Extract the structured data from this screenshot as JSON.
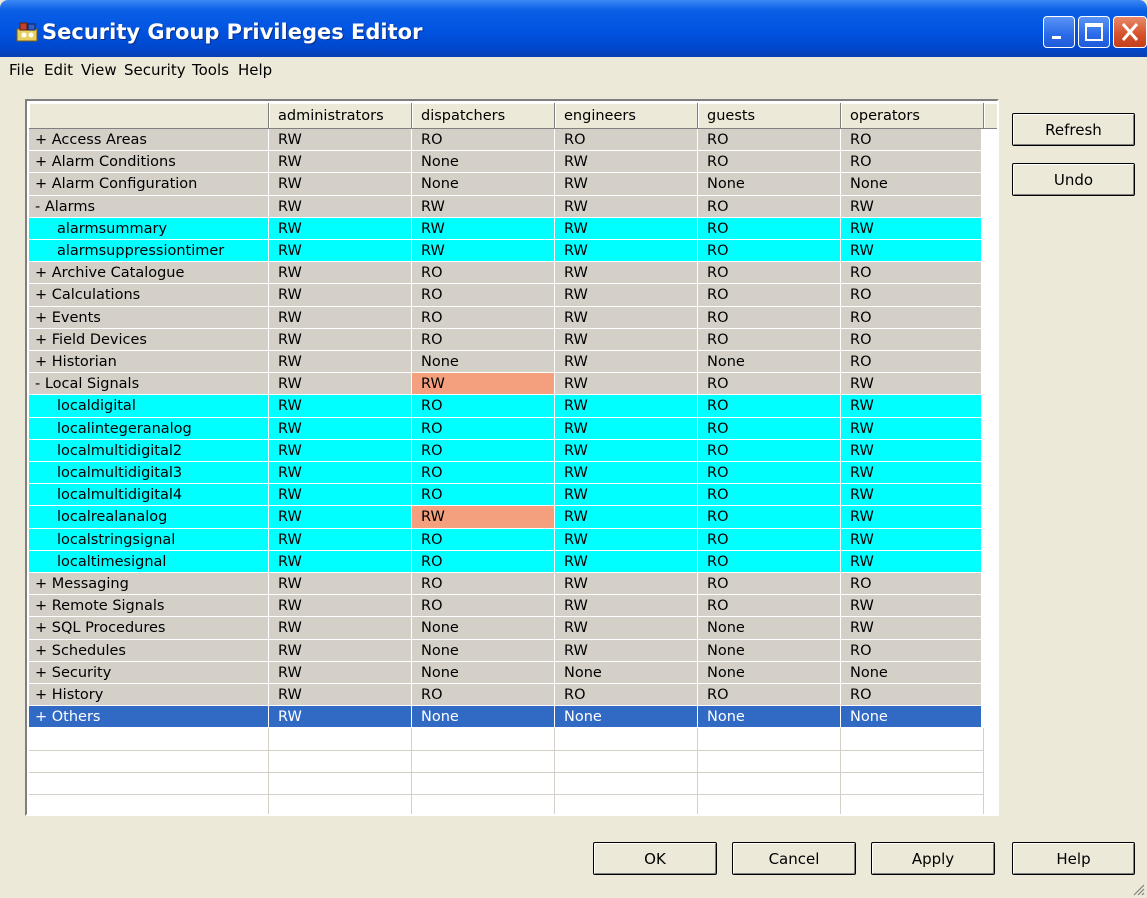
{
  "window": {
    "title": "Security Group Privileges Editor"
  },
  "menu": [
    "File",
    "Edit",
    "View",
    "Security",
    "Tools",
    "Help"
  ],
  "columns": [
    "administrators",
    "dispatchers",
    "engineers",
    "guests",
    "operators"
  ],
  "rows": [
    {
      "label": "+ Access Areas",
      "type": "group",
      "values": [
        "RW",
        "RO",
        "RO",
        "RO",
        "RO"
      ]
    },
    {
      "label": "+ Alarm Conditions",
      "type": "group",
      "values": [
        "RW",
        "None",
        "RW",
        "RO",
        "RO"
      ]
    },
    {
      "label": "+ Alarm Configuration",
      "type": "group",
      "values": [
        "RW",
        "None",
        "RW",
        "None",
        "None"
      ]
    },
    {
      "label": "- Alarms",
      "type": "group",
      "values": [
        "RW",
        "RW",
        "RW",
        "RO",
        "RW"
      ]
    },
    {
      "label": "alarmsummary",
      "type": "child",
      "values": [
        "RW",
        "RW",
        "RW",
        "RO",
        "RW"
      ]
    },
    {
      "label": "alarmsuppressiontimer",
      "type": "child",
      "values": [
        "RW",
        "RW",
        "RW",
        "RO",
        "RW"
      ]
    },
    {
      "label": "+ Archive Catalogue",
      "type": "group",
      "values": [
        "RW",
        "RO",
        "RW",
        "RO",
        "RO"
      ]
    },
    {
      "label": "+ Calculations",
      "type": "group",
      "values": [
        "RW",
        "RO",
        "RW",
        "RO",
        "RO"
      ]
    },
    {
      "label": "+ Events",
      "type": "group",
      "values": [
        "RW",
        "RO",
        "RW",
        "RO",
        "RO"
      ]
    },
    {
      "label": "+ Field Devices",
      "type": "group",
      "values": [
        "RW",
        "RO",
        "RW",
        "RO",
        "RO"
      ]
    },
    {
      "label": "+ Historian",
      "type": "group",
      "values": [
        "RW",
        "None",
        "RW",
        "None",
        "RO"
      ]
    },
    {
      "label": "- Local Signals",
      "type": "group",
      "values": [
        "RW",
        "RW",
        "RW",
        "RO",
        "RW"
      ],
      "highlight": [
        1
      ]
    },
    {
      "label": "localdigital",
      "type": "child",
      "values": [
        "RW",
        "RO",
        "RW",
        "RO",
        "RW"
      ]
    },
    {
      "label": "localintegeranalog",
      "type": "child",
      "values": [
        "RW",
        "RO",
        "RW",
        "RO",
        "RW"
      ]
    },
    {
      "label": "localmultidigital2",
      "type": "child",
      "values": [
        "RW",
        "RO",
        "RW",
        "RO",
        "RW"
      ]
    },
    {
      "label": "localmultidigital3",
      "type": "child",
      "values": [
        "RW",
        "RO",
        "RW",
        "RO",
        "RW"
      ]
    },
    {
      "label": "localmultidigital4",
      "type": "child",
      "values": [
        "RW",
        "RO",
        "RW",
        "RO",
        "RW"
      ]
    },
    {
      "label": "localrealanalog",
      "type": "child",
      "values": [
        "RW",
        "RW",
        "RW",
        "RO",
        "RW"
      ],
      "highlight": [
        1
      ]
    },
    {
      "label": "localstringsignal",
      "type": "child",
      "values": [
        "RW",
        "RO",
        "RW",
        "RO",
        "RW"
      ]
    },
    {
      "label": "localtimesignal",
      "type": "child",
      "values": [
        "RW",
        "RO",
        "RW",
        "RO",
        "RW"
      ]
    },
    {
      "label": "+ Messaging",
      "type": "group",
      "values": [
        "RW",
        "RO",
        "RW",
        "RO",
        "RO"
      ]
    },
    {
      "label": "+ Remote Signals",
      "type": "group",
      "values": [
        "RW",
        "RO",
        "RW",
        "RO",
        "RW"
      ]
    },
    {
      "label": "+ SQL Procedures",
      "type": "group",
      "values": [
        "RW",
        "None",
        "RW",
        "None",
        "RW"
      ]
    },
    {
      "label": "+ Schedules",
      "type": "group",
      "values": [
        "RW",
        "None",
        "RW",
        "None",
        "RO"
      ]
    },
    {
      "label": "+ Security",
      "type": "group",
      "values": [
        "RW",
        "None",
        "None",
        "None",
        "None"
      ]
    },
    {
      "label": "+ History",
      "type": "group",
      "values": [
        "RW",
        "RO",
        "RO",
        "RO",
        "RO"
      ]
    },
    {
      "label": "+ Others",
      "type": "selected",
      "values": [
        "RW",
        "None",
        "None",
        "None",
        "None"
      ]
    }
  ],
  "buttons": {
    "refresh": "Refresh",
    "undo": "Undo",
    "ok": "OK",
    "cancel": "Cancel",
    "apply": "Apply",
    "help": "Help"
  },
  "colors": {
    "group_row": "#d4d0c8",
    "child_row": "#00ffff",
    "selected_row": "#316ac5",
    "changed_cell": "#f4a07f",
    "titlebar": "#0053e0"
  },
  "icons": [
    "app-icon",
    "minimize-icon",
    "maximize-icon",
    "close-icon",
    "resize-grip-icon"
  ]
}
